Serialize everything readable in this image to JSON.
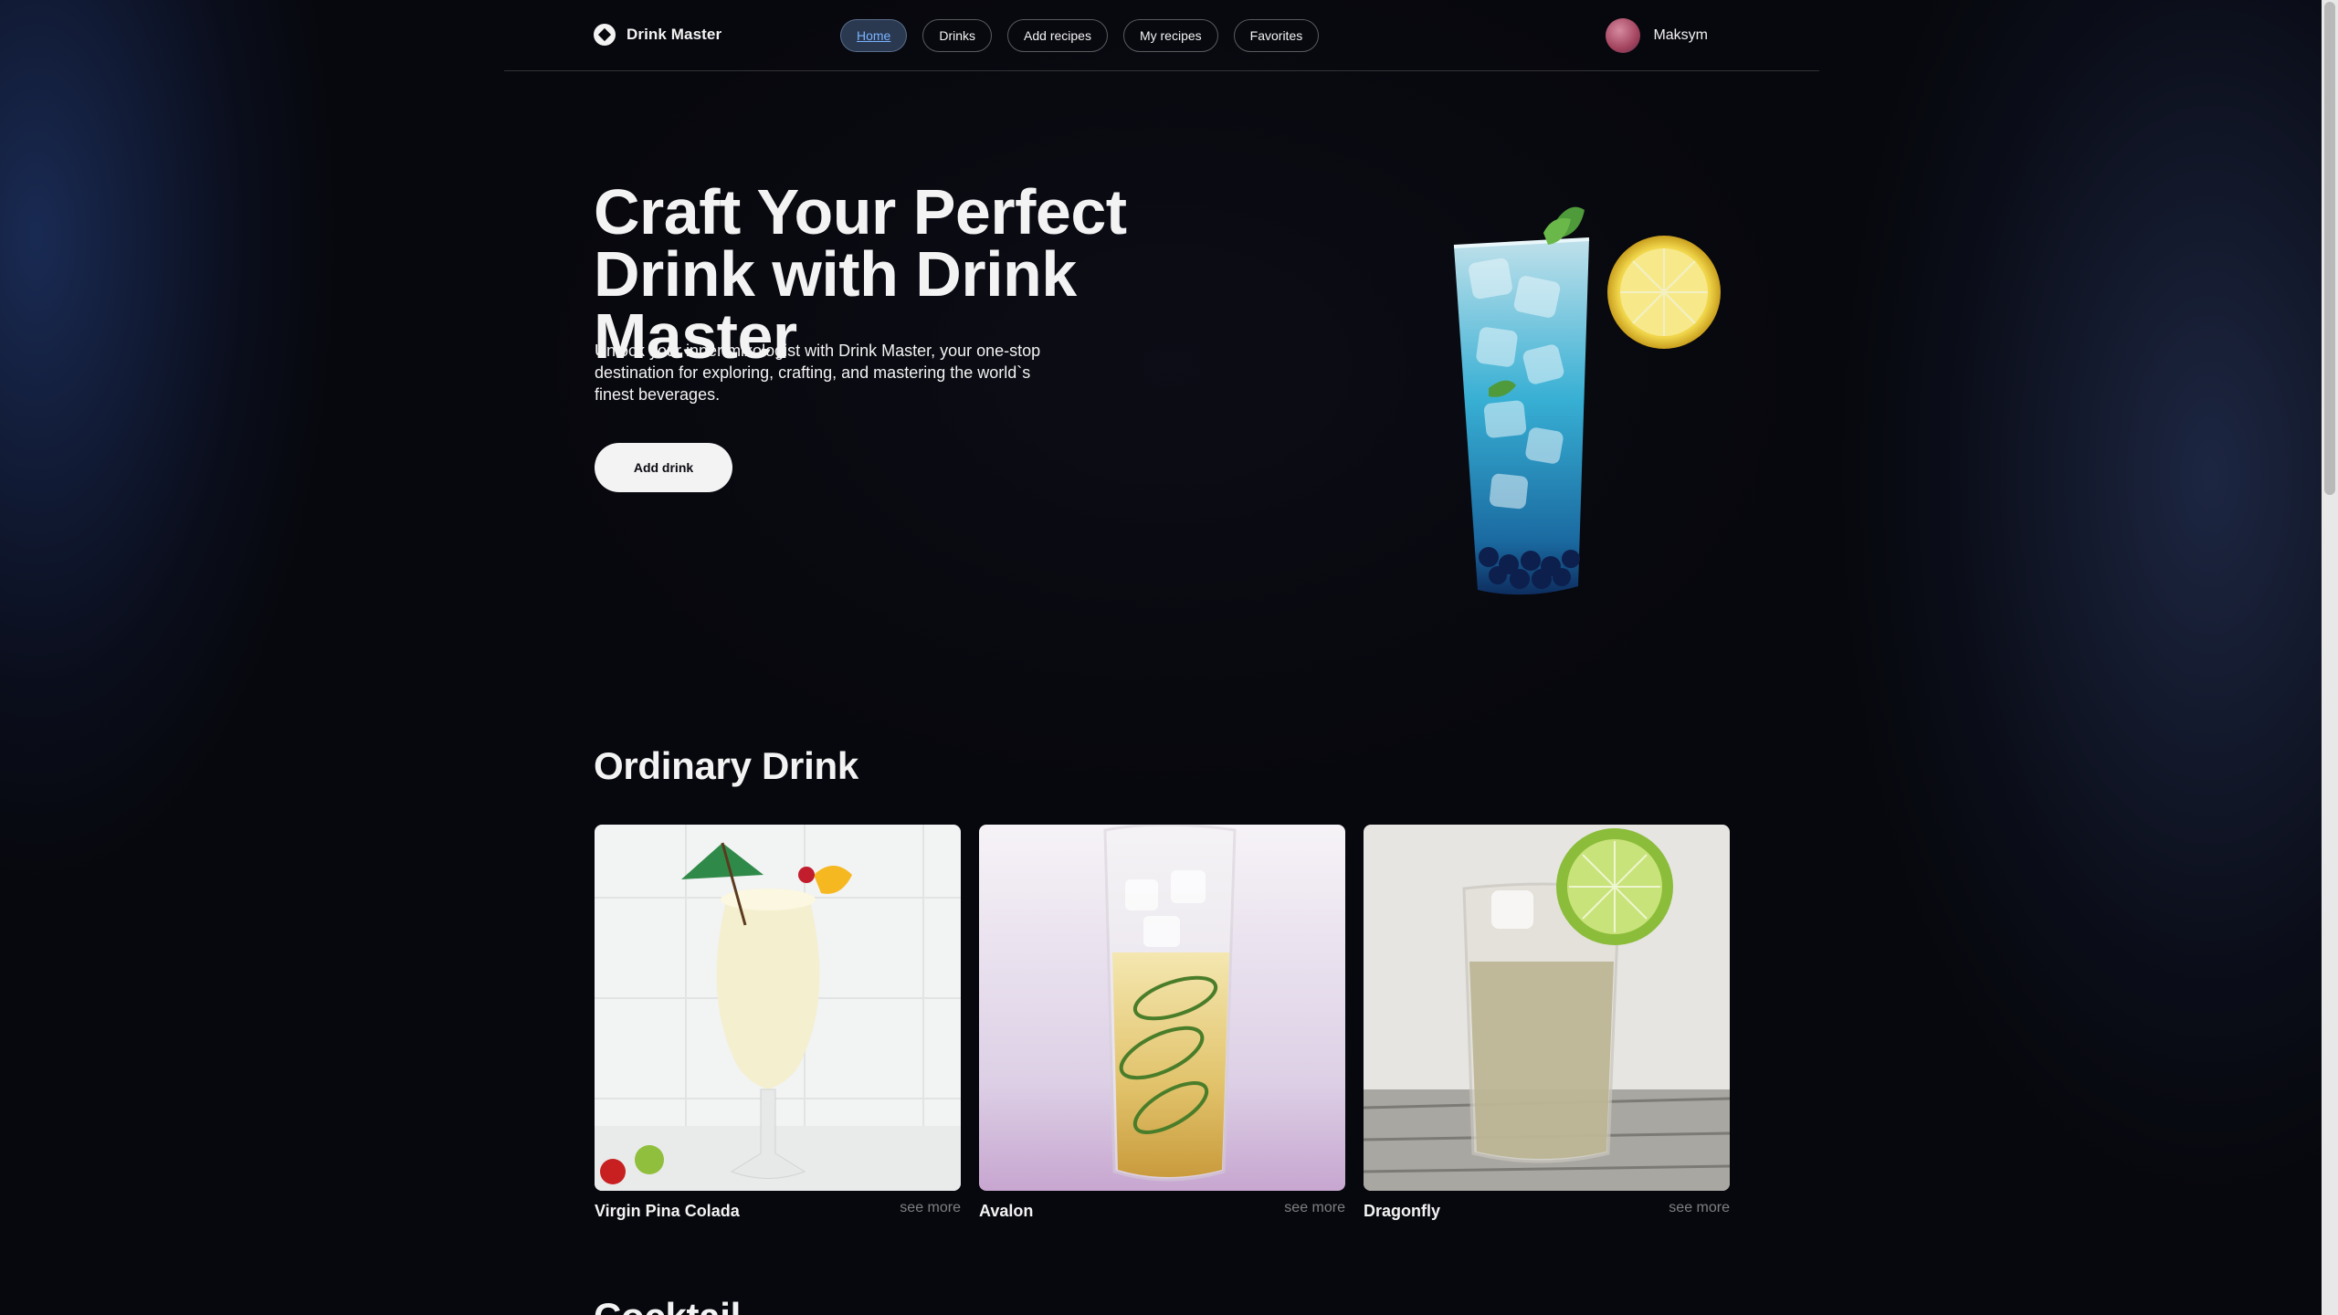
{
  "header": {
    "logo_text": "Drink Master",
    "nav": [
      {
        "label": "Home",
        "active": true
      },
      {
        "label": "Drinks"
      },
      {
        "label": "Add recipes"
      },
      {
        "label": "My recipes"
      },
      {
        "label": "Favorites"
      }
    ],
    "user_name": "Maksym"
  },
  "hero": {
    "title_line1": "Craft Your Perfect",
    "title_line2": "Drink with Drink Master",
    "description": "Unlock your inner mixologist with Drink Master, your one-stop destination for exploring, crafting, and mastering the world`s finest beverages.",
    "button_label": "Add drink"
  },
  "sections": [
    {
      "title": "Ordinary Drink",
      "cards": [
        {
          "name": "Virgin Pina Colada",
          "link": "see more"
        },
        {
          "name": "Avalon",
          "link": "see more"
        },
        {
          "name": "Dragonfly",
          "link": "see more"
        }
      ]
    },
    {
      "title": "Cocktail"
    }
  ],
  "colors": {
    "background": "#07080d",
    "text": "#f3f3f3",
    "active_nav_text": "#7ab4ff"
  }
}
